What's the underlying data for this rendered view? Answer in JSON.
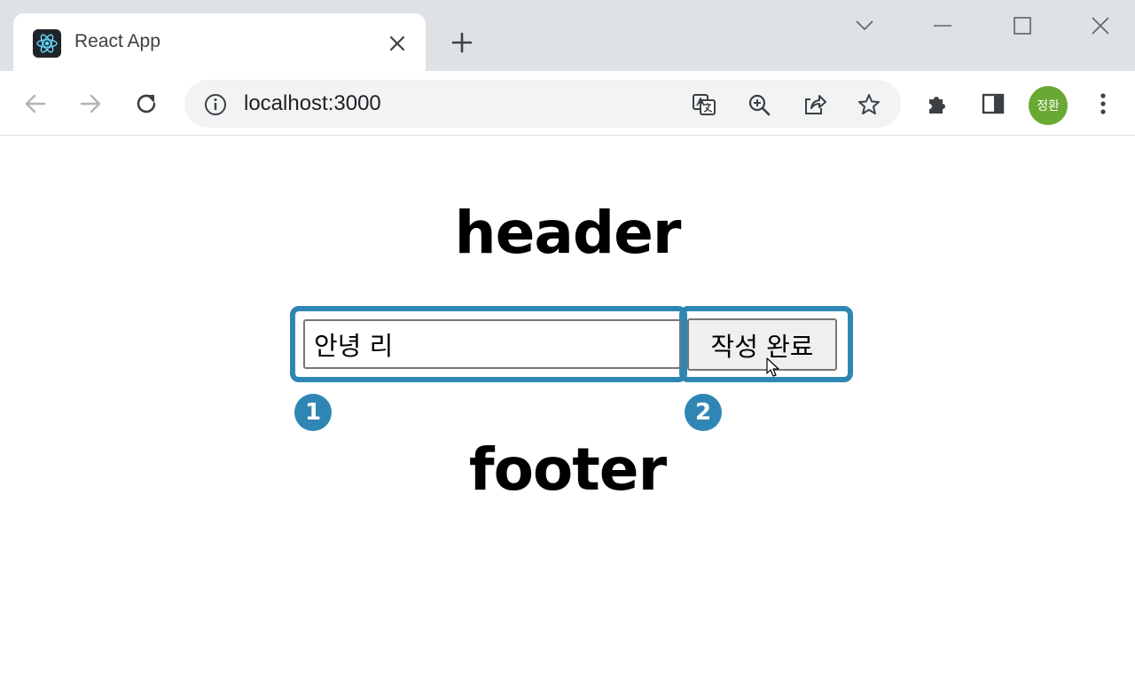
{
  "browser": {
    "tab": {
      "title": "React App"
    },
    "address": {
      "url": "localhost:3000"
    },
    "profile": {
      "initials": "정환",
      "color": "#6aa834"
    },
    "icons": {
      "favicon": "react-logo-icon",
      "tab_close": "close-icon",
      "new_tab": "plus-icon",
      "tab_search": "chevron-down-icon",
      "minimize": "minimize-icon",
      "maximize": "maximize-icon",
      "close_window": "close-icon",
      "back": "arrow-left-icon",
      "forward": "arrow-right-icon",
      "reload": "reload-icon",
      "site_info": "info-icon",
      "translate": "translate-icon",
      "zoom": "zoom-icon",
      "share": "share-icon",
      "bookmark": "star-icon",
      "extensions": "puzzle-icon",
      "side_panel": "side-panel-icon",
      "menu": "more-vertical-icon"
    }
  },
  "page": {
    "header_text": "header",
    "footer_text": "footer",
    "input": {
      "value": "안녕 리"
    },
    "submit_label": "작성 완료",
    "annotations": {
      "badge_1": "1",
      "badge_2": "2",
      "highlight_color": "#2f86b4"
    }
  }
}
